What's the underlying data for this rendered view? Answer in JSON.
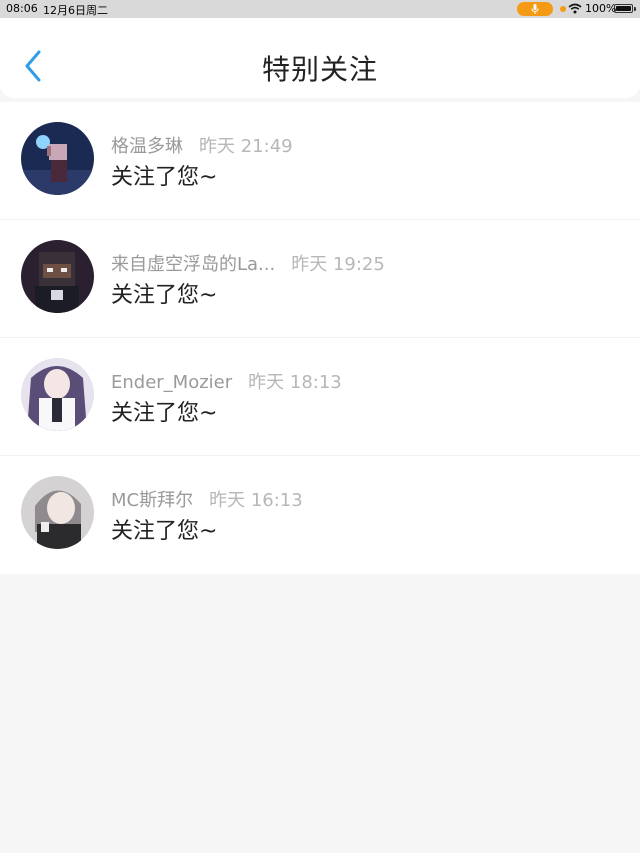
{
  "status_bar": {
    "time": "08:06",
    "date": "12月6日周二",
    "battery_text": "100%",
    "accent_color": "#f59a14"
  },
  "nav": {
    "title": "特别关注",
    "back_icon": "chevron-left-icon",
    "back_color": "#2f9ee8"
  },
  "items": [
    {
      "name": "格温多琳",
      "time": "昨天 21:49",
      "message": "关注了您~"
    },
    {
      "name": "来自虚空浮岛的La...",
      "time": "昨天 19:25",
      "message": "关注了您~"
    },
    {
      "name": "Ender_Mozier",
      "time": "昨天 18:13",
      "message": "关注了您~"
    },
    {
      "name": "MC斯拜尔",
      "time": "昨天 16:13",
      "message": "关注了您~"
    }
  ]
}
